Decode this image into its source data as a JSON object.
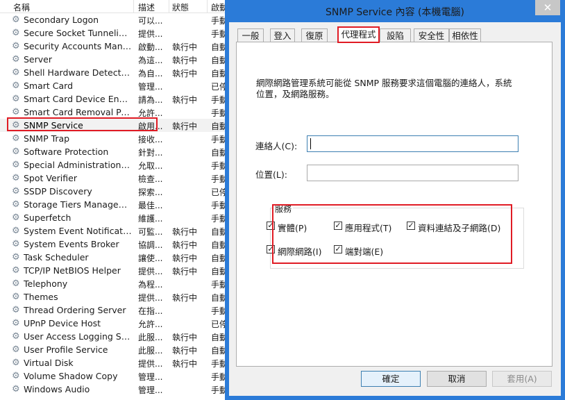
{
  "services_list": {
    "headers": {
      "name": "名稱",
      "desc": "描述",
      "status": "狀態",
      "startup": "啟動"
    },
    "rows": [
      {
        "name": "Secondary Logon",
        "desc": "可以...",
        "status": "",
        "startup": "手動"
      },
      {
        "name": "Secure Socket Tunneling ...",
        "desc": "提供...",
        "status": "",
        "startup": "手動"
      },
      {
        "name": "Security Accounts Manager",
        "desc": "啟動...",
        "status": "執行中",
        "startup": "自動"
      },
      {
        "name": "Server",
        "desc": "為這...",
        "status": "執行中",
        "startup": "自動"
      },
      {
        "name": "Shell Hardware Detection",
        "desc": "為自...",
        "status": "執行中",
        "startup": "自動"
      },
      {
        "name": "Smart Card",
        "desc": "管理...",
        "status": "",
        "startup": "已停"
      },
      {
        "name": "Smart Card Device Enume...",
        "desc": "請為...",
        "status": "執行中",
        "startup": "手動"
      },
      {
        "name": "Smart Card Removal Policy",
        "desc": "允許...",
        "status": "",
        "startup": "手動"
      },
      {
        "name": "SNMP Service",
        "desc": "啟用...",
        "status": "執行中",
        "startup": "自動"
      },
      {
        "name": "SNMP Trap",
        "desc": "接收...",
        "status": "",
        "startup": "手動"
      },
      {
        "name": "Software Protection",
        "desc": "針對...",
        "status": "",
        "startup": "自動"
      },
      {
        "name": "Special Administration Co...",
        "desc": "允取...",
        "status": "",
        "startup": "手動"
      },
      {
        "name": "Spot Verifier",
        "desc": "檢查...",
        "status": "",
        "startup": "手動"
      },
      {
        "name": "SSDP Discovery",
        "desc": "探索...",
        "status": "",
        "startup": "已停"
      },
      {
        "name": "Storage Tiers Management",
        "desc": "最佳...",
        "status": "",
        "startup": "手動"
      },
      {
        "name": "Superfetch",
        "desc": "維護...",
        "status": "",
        "startup": "手動"
      },
      {
        "name": "System Event Notification ...",
        "desc": "可監...",
        "status": "執行中",
        "startup": "自動"
      },
      {
        "name": "System Events Broker",
        "desc": "協調...",
        "status": "執行中",
        "startup": "自動"
      },
      {
        "name": "Task Scheduler",
        "desc": "讓使...",
        "status": "執行中",
        "startup": "自動"
      },
      {
        "name": "TCP/IP NetBIOS Helper",
        "desc": "提供...",
        "status": "執行中",
        "startup": "自動"
      },
      {
        "name": "Telephony",
        "desc": "為程...",
        "status": "",
        "startup": "手動"
      },
      {
        "name": "Themes",
        "desc": "提供...",
        "status": "執行中",
        "startup": "自動"
      },
      {
        "name": "Thread Ordering Server",
        "desc": "在指...",
        "status": "",
        "startup": "手動"
      },
      {
        "name": "UPnP Device Host",
        "desc": "允許...",
        "status": "",
        "startup": "已停"
      },
      {
        "name": "User Access Logging Servi...",
        "desc": "此服...",
        "status": "執行中",
        "startup": "自動"
      },
      {
        "name": "User Profile Service",
        "desc": "此服...",
        "status": "執行中",
        "startup": "自動"
      },
      {
        "name": "Virtual Disk",
        "desc": "提供...",
        "status": "執行中",
        "startup": "手動"
      },
      {
        "name": "Volume Shadow Copy",
        "desc": "管理...",
        "status": "",
        "startup": "手動"
      },
      {
        "name": "Windows Audio",
        "desc": "管理...",
        "status": "",
        "startup": "手動"
      }
    ]
  },
  "dialog": {
    "title": "SNMP Service 內容 (本機電腦)",
    "close_glyph": "✕",
    "tabs": [
      {
        "label": "一般"
      },
      {
        "label": "登入"
      },
      {
        "label": "復原"
      },
      {
        "label": "代理程式"
      },
      {
        "label": "設陷"
      },
      {
        "label": "安全性"
      },
      {
        "label": "相依性"
      }
    ],
    "active_tab": "代理程式",
    "description": "網際網路管理系統可能從 SNMP 服務要求這個電腦的連絡人，系統位置，及網路服務。",
    "contact_label": "連絡人(C):",
    "contact_value": "",
    "location_label": "位置(L):",
    "location_value": "",
    "services_group_label": "服務",
    "services": [
      {
        "label": "實體(P)",
        "checked": true
      },
      {
        "label": "應用程式(T)",
        "checked": true
      },
      {
        "label": "資料連結及子網路(D)",
        "checked": true
      },
      {
        "label": "網際網路(I)",
        "checked": true
      },
      {
        "label": "端對端(E)",
        "checked": true
      }
    ],
    "buttons": {
      "ok": "確定",
      "cancel": "取消",
      "apply": "套用(A)"
    },
    "check_glyph": "✓"
  },
  "colors": {
    "window_frame": "#2b7bd8",
    "highlight": "#e01b24"
  },
  "icons": {
    "service": "gear-icon",
    "close": "close-icon",
    "checkbox": "checkmark-icon"
  }
}
